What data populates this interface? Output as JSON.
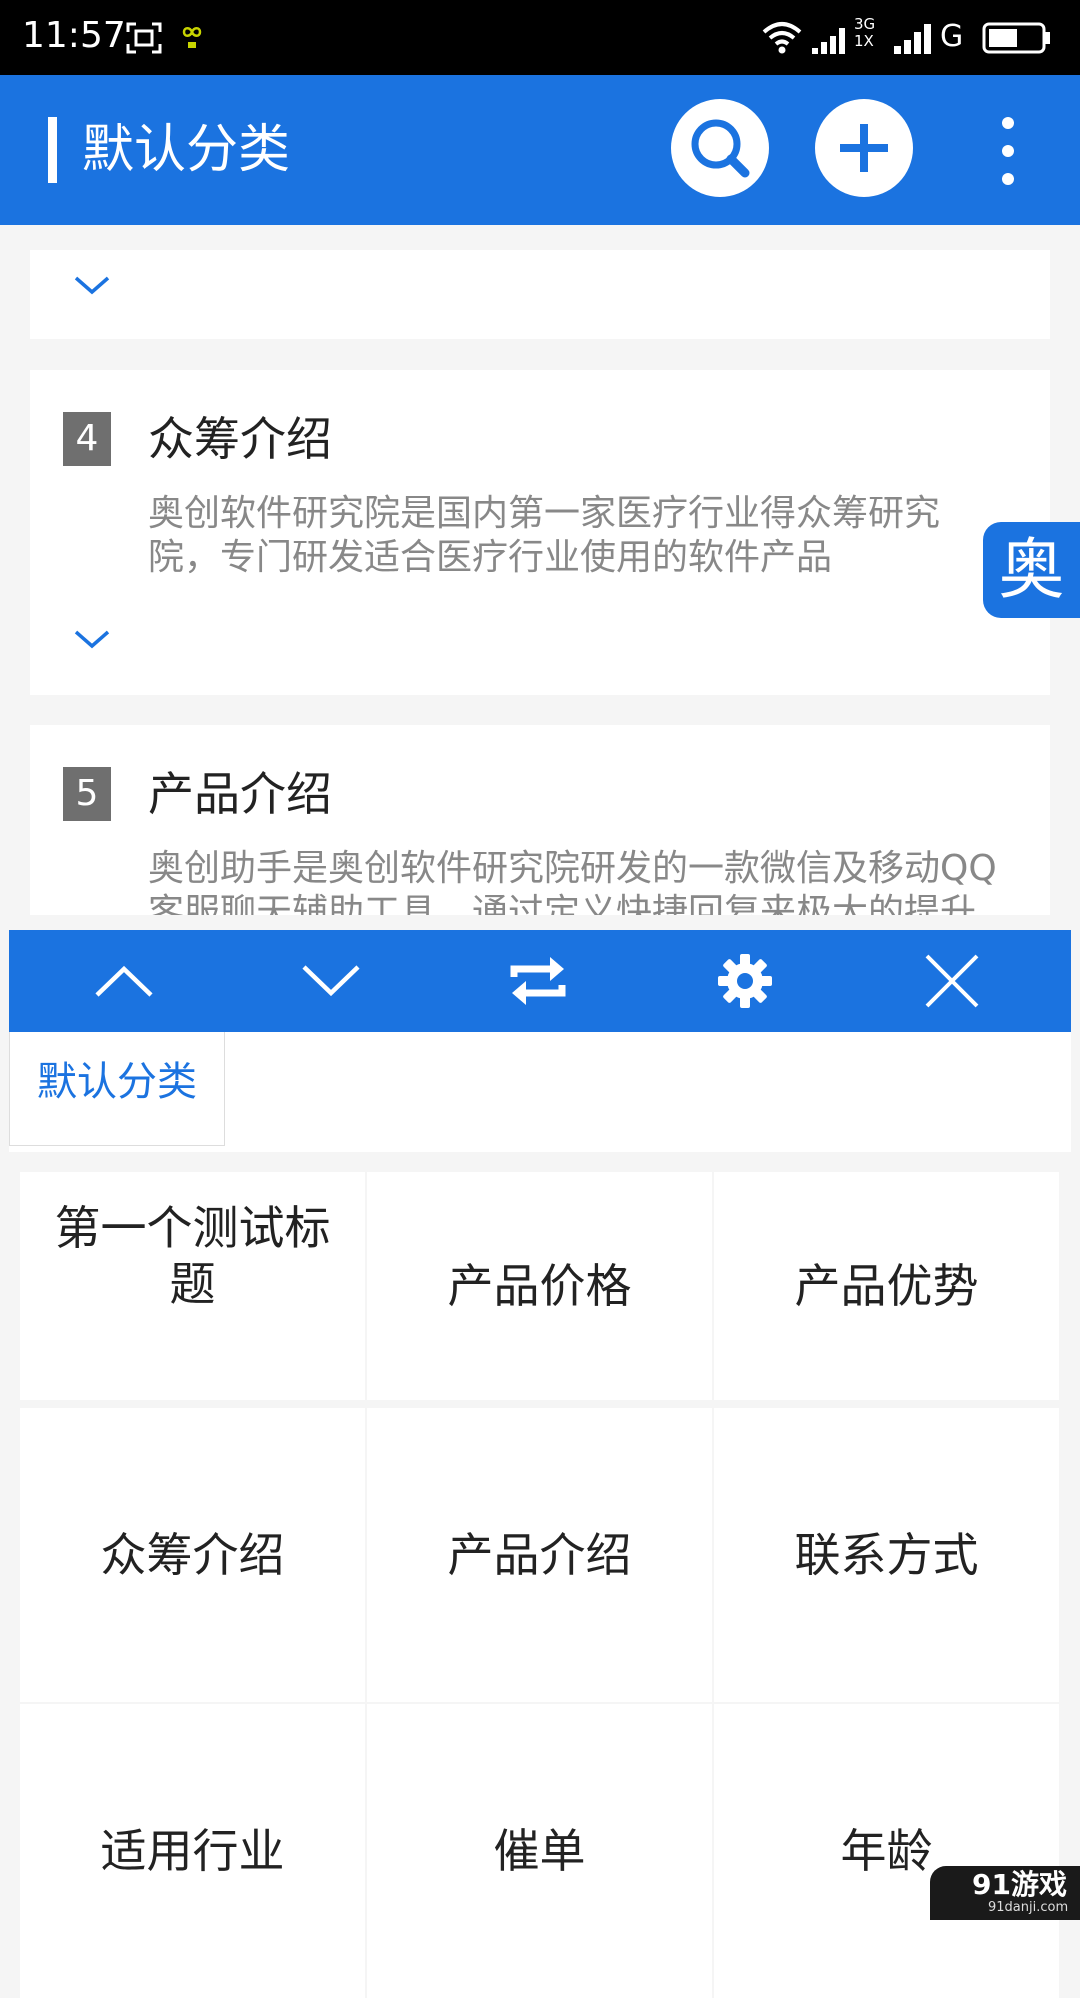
{
  "status_bar": {
    "time": "11:57",
    "network_type": "3G\n1X",
    "network_label_top": "3G",
    "network_label_bottom": "1X",
    "carrier2": "G"
  },
  "app_bar": {
    "title": "默认分类",
    "icons": [
      "search-icon",
      "plus-icon",
      "more-vertical-icon"
    ]
  },
  "cards": [
    {
      "number": "",
      "title": "",
      "description": ""
    },
    {
      "number": "4",
      "title": "众筹介绍",
      "description": "奥创软件研究院是国内第一家医疗行业得众筹研究院，专门研发适合医疗行业使用的软件产品"
    },
    {
      "number": "5",
      "title": "产品介绍",
      "description": "奥创助手是奥创软件研究院研发的一款微信及移动QQ客服聊天辅助工具，通过定义快捷回复来极大的提升"
    }
  ],
  "float_badge": "奥",
  "toolbar": {
    "icons": [
      "chevron-up-icon",
      "chevron-down-icon",
      "swap-icon",
      "gear-icon",
      "close-icon"
    ]
  },
  "tabs": [
    {
      "label": "默认分类",
      "active": true
    }
  ],
  "grid": [
    "第一个测试标题",
    "产品价格",
    "产品优势",
    "众筹介绍",
    "产品介绍",
    "联系方式",
    "适用行业",
    "催单",
    "年龄"
  ],
  "watermark": {
    "main": "91游戏",
    "sub": "91danji.com"
  },
  "colors": {
    "primary": "#1b73e0",
    "background": "#f5f5f5",
    "number_badge": "#6f6f6f",
    "description_text": "#888888"
  }
}
